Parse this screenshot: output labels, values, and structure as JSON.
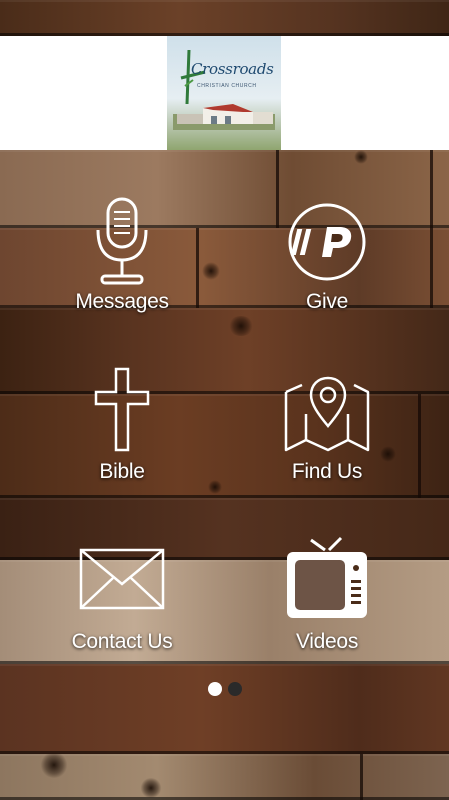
{
  "header": {
    "logo_brand": "Crossroads",
    "logo_sub": "CHRISTIAN CHURCH"
  },
  "menu": {
    "items": [
      {
        "label": "Messages",
        "icon": "microphone-icon"
      },
      {
        "label": "Give",
        "icon": "pushpay-p-icon"
      },
      {
        "label": "Bible",
        "icon": "cross-icon"
      },
      {
        "label": "Find Us",
        "icon": "map-pin-icon"
      },
      {
        "label": "Contact Us",
        "icon": "envelope-icon"
      },
      {
        "label": "Videos",
        "icon": "tv-icon"
      }
    ]
  },
  "pager": {
    "pages": 2,
    "current": 1
  },
  "colors": {
    "header_bg": "#ffffff",
    "label_text": "#ffffff",
    "dot_active": "#ffffff",
    "dot_inactive": "#2a2a2a",
    "logo_text": "#1f4a70"
  }
}
